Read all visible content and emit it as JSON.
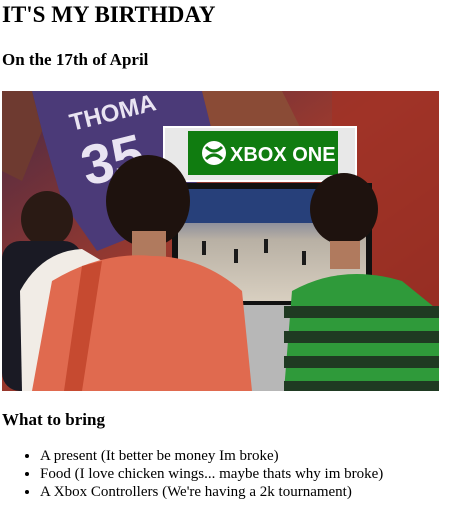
{
  "page": {
    "title": "IT'S MY BIRTHDAY",
    "subtitle": "On the 17th of April"
  },
  "photo": {
    "kiosk_logo_text": "XBOX ONE",
    "jersey_number": "35",
    "jersey_name": "THOMA"
  },
  "bring": {
    "heading": "What to bring",
    "items": [
      "A present (It better be money Im broke)",
      "Food (I love chicken wings... maybe thats why im broke)",
      "A Xbox Controllers (We're having a 2k tournament)"
    ]
  },
  "colors": {
    "xbox_green": "#107c10",
    "shirt_coral": "#e06a4f",
    "stripe_green": "#2f9a3a"
  }
}
